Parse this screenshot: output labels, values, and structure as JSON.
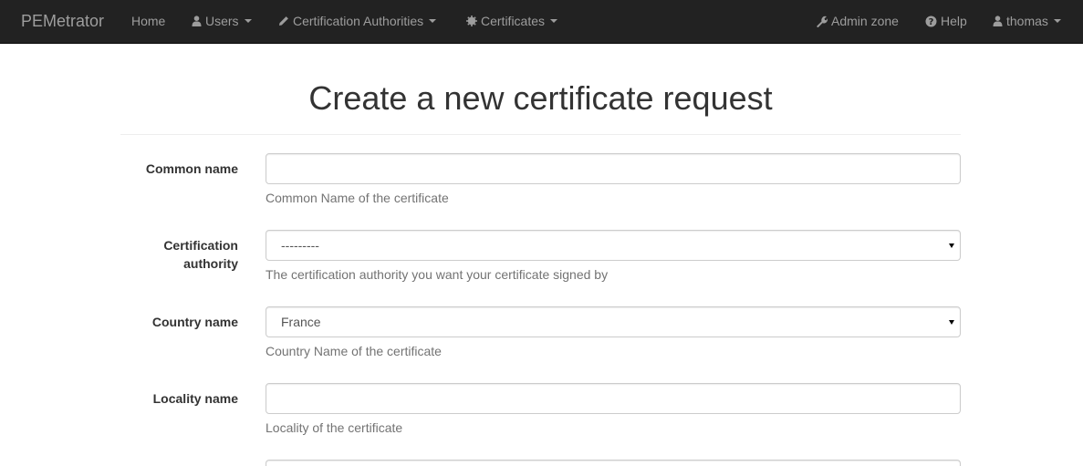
{
  "navbar": {
    "brand": "PEMetrator",
    "home": "Home",
    "users": "Users",
    "certification_authorities": "Certification Authorities",
    "certificates": "Certificates",
    "admin_zone": "Admin zone",
    "help": "Help",
    "user": "thomas"
  },
  "page": {
    "title": "Create a new certificate request"
  },
  "form": {
    "common_name": {
      "label": "Common name",
      "value": "",
      "help": "Common Name of the certificate"
    },
    "certification_authority": {
      "label_line1": "Certification",
      "label_line2": "authority",
      "selected": "---------",
      "help": "The certification authority you want your certificate signed by"
    },
    "country_name": {
      "label": "Country name",
      "selected": "France",
      "help": "Country Name of the certificate"
    },
    "locality_name": {
      "label": "Locality name",
      "value": "",
      "help": "Locality of the certificate"
    }
  },
  "colors": {
    "navbar_bg": "#222222",
    "navbar_text": "#9d9d9d",
    "help_text": "#737373",
    "input_border": "#cccccc"
  }
}
